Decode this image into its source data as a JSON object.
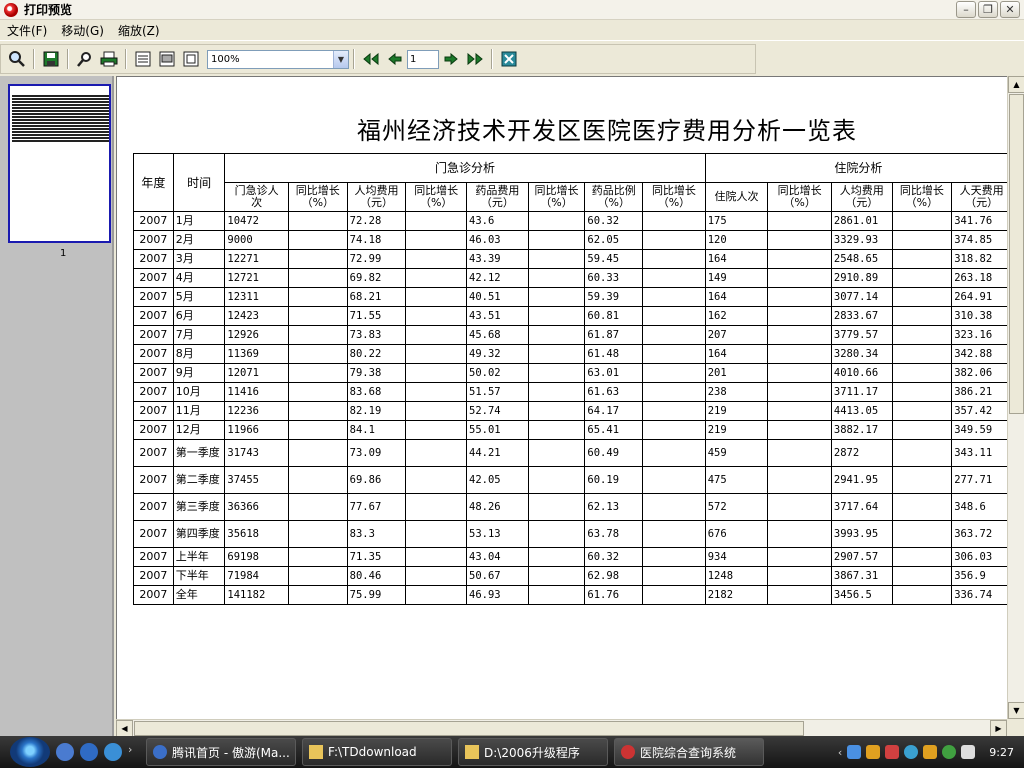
{
  "window": {
    "title": "打印预览"
  },
  "menu": [
    "文件(F)",
    "移动(G)",
    "缩放(Z)"
  ],
  "toolbar": {
    "zoom": "100%",
    "page": "1"
  },
  "thumbnail": {
    "page_label": "1"
  },
  "report": {
    "title": "福州经济技术开发区医院医疗费用分析一览表",
    "h_year": "年度",
    "h_time": "时间",
    "h_outpatient": "门急诊分析",
    "h_inpatient": "住院分析",
    "sub": [
      [
        "门急诊人",
        "次"
      ],
      [
        "同比增长",
        "（%）"
      ],
      [
        "人均费用",
        "（元）"
      ],
      [
        "同比增长",
        "（%）"
      ],
      [
        "药品费用",
        "（元）"
      ],
      [
        "同比增长",
        "（%）"
      ],
      [
        "药品比例",
        "（%）"
      ],
      [
        "同比增长",
        "（%）"
      ],
      [
        "住院人次",
        ""
      ],
      [
        "同比增长",
        "（%）"
      ],
      [
        "人均费用",
        "（元）"
      ],
      [
        "同比增长",
        "（%）"
      ],
      [
        "人天费用",
        "（元）"
      ]
    ],
    "rows": [
      [
        "2007",
        "1月",
        "10472",
        "",
        "72.28",
        "",
        "43.6",
        "",
        "60.32",
        "",
        "175",
        "",
        "2861.01",
        "",
        "341.76"
      ],
      [
        "2007",
        "2月",
        "9000",
        "",
        "74.18",
        "",
        "46.03",
        "",
        "62.05",
        "",
        "120",
        "",
        "3329.93",
        "",
        "374.85"
      ],
      [
        "2007",
        "3月",
        "12271",
        "",
        "72.99",
        "",
        "43.39",
        "",
        "59.45",
        "",
        "164",
        "",
        "2548.65",
        "",
        "318.82"
      ],
      [
        "2007",
        "4月",
        "12721",
        "",
        "69.82",
        "",
        "42.12",
        "",
        "60.33",
        "",
        "149",
        "",
        "2910.89",
        "",
        "263.18"
      ],
      [
        "2007",
        "5月",
        "12311",
        "",
        "68.21",
        "",
        "40.51",
        "",
        "59.39",
        "",
        "164",
        "",
        "3077.14",
        "",
        "264.91"
      ],
      [
        "2007",
        "6月",
        "12423",
        "",
        "71.55",
        "",
        "43.51",
        "",
        "60.81",
        "",
        "162",
        "",
        "2833.67",
        "",
        "310.38"
      ],
      [
        "2007",
        "7月",
        "12926",
        "",
        "73.83",
        "",
        "45.68",
        "",
        "61.87",
        "",
        "207",
        "",
        "3779.57",
        "",
        "323.16"
      ],
      [
        "2007",
        "8月",
        "11369",
        "",
        "80.22",
        "",
        "49.32",
        "",
        "61.48",
        "",
        "164",
        "",
        "3280.34",
        "",
        "342.88"
      ],
      [
        "2007",
        "9月",
        "12071",
        "",
        "79.38",
        "",
        "50.02",
        "",
        "63.01",
        "",
        "201",
        "",
        "4010.66",
        "",
        "382.06"
      ],
      [
        "2007",
        "10月",
        "11416",
        "",
        "83.68",
        "",
        "51.57",
        "",
        "61.63",
        "",
        "238",
        "",
        "3711.17",
        "",
        "386.21"
      ],
      [
        "2007",
        "11月",
        "12236",
        "",
        "82.19",
        "",
        "52.74",
        "",
        "64.17",
        "",
        "219",
        "",
        "4413.05",
        "",
        "357.42"
      ],
      [
        "2007",
        "12月",
        "11966",
        "",
        "84.1",
        "",
        "55.01",
        "",
        "65.41",
        "",
        "219",
        "",
        "3882.17",
        "",
        "349.59"
      ],
      [
        "2007",
        "第一季度",
        "31743",
        "",
        "73.09",
        "",
        "44.21",
        "",
        "60.49",
        "",
        "459",
        "",
        "2872",
        "",
        "343.11"
      ],
      [
        "2007",
        "第二季度",
        "37455",
        "",
        "69.86",
        "",
        "42.05",
        "",
        "60.19",
        "",
        "475",
        "",
        "2941.95",
        "",
        "277.71"
      ],
      [
        "2007",
        "第三季度",
        "36366",
        "",
        "77.67",
        "",
        "48.26",
        "",
        "62.13",
        "",
        "572",
        "",
        "3717.64",
        "",
        "348.6"
      ],
      [
        "2007",
        "第四季度",
        "35618",
        "",
        "83.3",
        "",
        "53.13",
        "",
        "63.78",
        "",
        "676",
        "",
        "3993.95",
        "",
        "363.72"
      ],
      [
        "2007",
        "上半年",
        "69198",
        "",
        "71.35",
        "",
        "43.04",
        "",
        "60.32",
        "",
        "934",
        "",
        "2907.57",
        "",
        "306.03"
      ],
      [
        "2007",
        "下半年",
        "71984",
        "",
        "80.46",
        "",
        "50.67",
        "",
        "62.98",
        "",
        "1248",
        "",
        "3867.31",
        "",
        "356.9"
      ],
      [
        "2007",
        "全年",
        "141182",
        "",
        "75.99",
        "",
        "46.93",
        "",
        "61.76",
        "",
        "2182",
        "",
        "3456.5",
        "",
        "336.74"
      ]
    ]
  },
  "taskbar": {
    "tasks": [
      "腾讯首页 - 傲游(Ma...",
      "F:\\TDdownload",
      "D:\\2006升级程序",
      "医院综合查询系统"
    ],
    "clock": "9:27"
  }
}
